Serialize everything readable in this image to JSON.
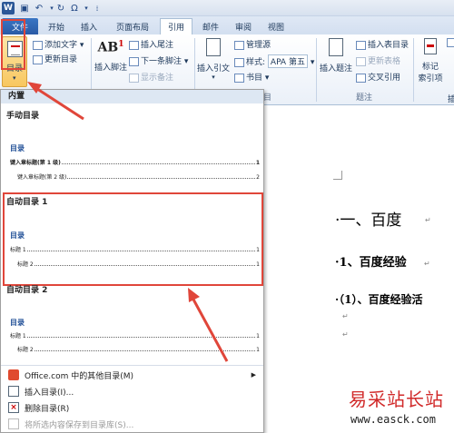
{
  "qat": {
    "redo_symbol": "Ω"
  },
  "tabs": [
    "文件",
    "开始",
    "插入",
    "页面布局",
    "引用",
    "邮件",
    "审阅",
    "视图"
  ],
  "ribbon": {
    "toc_label": "目录",
    "add_text": "添加文字",
    "update_toc": "更新目录",
    "insert_footnote": "插入脚注",
    "insert_endnote": "插入尾注",
    "next_footnote": "下一条脚注",
    "show_notes": "显示备注",
    "footnote_icon_text": "AB",
    "footnote_sup": "1",
    "insert_citation": "插入引文",
    "manage_sources": "管理源",
    "style_label": "样式:",
    "style_value": "APA 第五",
    "bibliography": "书目",
    "citation_group_tail": "目",
    "insert_caption": "插入题注",
    "insert_table_of_figures": "插入表目录",
    "update_table": "更新表格",
    "cross_reference": "交叉引用",
    "caption_group": "题注",
    "mark_entry": "标记",
    "mark_entry_2": "索引项",
    "index_tail": "插"
  },
  "dropdown": {
    "header": "内置",
    "manual": {
      "title": "手动目录",
      "heading": "目录",
      "lines": [
        {
          "label": "键入章标题(第 1 级)",
          "page": "1"
        },
        {
          "label": "键入章标题(第 2 级)",
          "page": "2"
        }
      ]
    },
    "auto1": {
      "title": "自动目录 1",
      "heading": "目录",
      "lines": [
        {
          "label": "标题 1",
          "page": "1"
        },
        {
          "label": "标题 2",
          "page": "1"
        }
      ]
    },
    "auto2": {
      "title": "自动目录 2",
      "heading": "目录",
      "lines": [
        {
          "label": "标题 1",
          "page": "1"
        },
        {
          "label": "标题 2",
          "page": "1"
        }
      ]
    },
    "menu": [
      {
        "label": "Office.com 中的其他目录(M)",
        "icon": "office-icon",
        "submenu": true,
        "disabled": false
      },
      {
        "label": "插入目录(I)...",
        "icon": "insert-toc-icon",
        "submenu": false,
        "disabled": false
      },
      {
        "label": "删除目录(R)",
        "icon": "delete-toc-icon",
        "submenu": false,
        "disabled": false
      },
      {
        "label": "将所选内容保存到目录库(S)...",
        "icon": "save-selection-icon",
        "submenu": false,
        "disabled": true
      }
    ]
  },
  "document": {
    "line1": "·一、百度",
    "line2": "·1、百度经验",
    "line3": "·（1）、百度经验活",
    "para_mark": "↵"
  },
  "watermark": {
    "cn": "易采站长站",
    "url": "www.easck.com"
  },
  "colors": {
    "highlight": "#e0463a",
    "accent": "#2b5797",
    "toc_heading": "#1f4e96"
  }
}
